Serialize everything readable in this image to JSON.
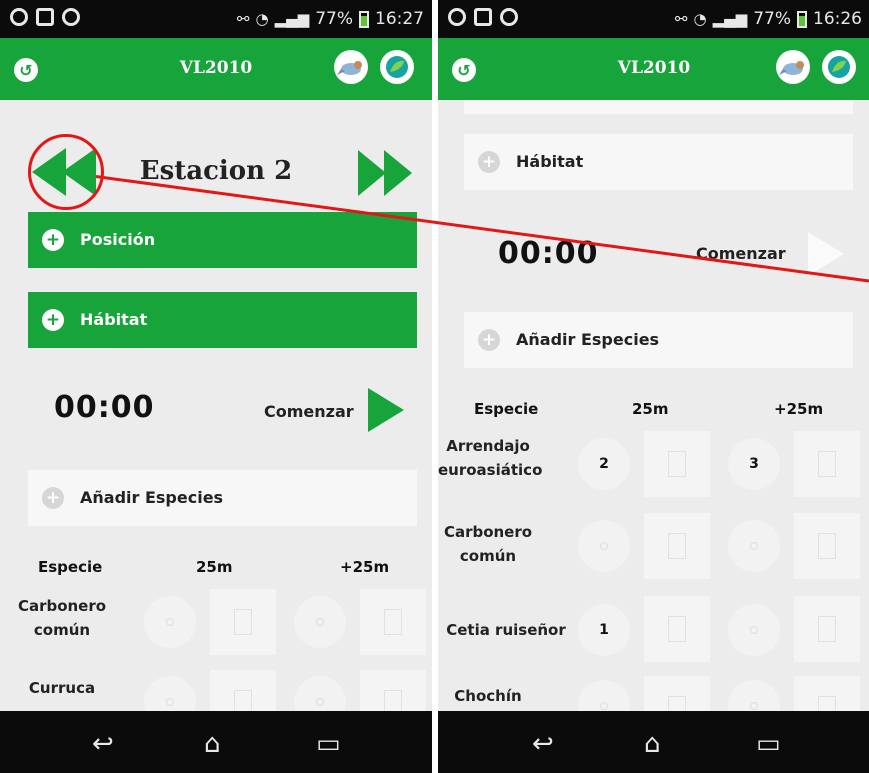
{
  "status_left": {
    "time": "16:27",
    "battery": "77%"
  },
  "status_right": {
    "time": "16:26",
    "battery": "77%"
  },
  "app": {
    "title": "VL2010",
    "back_icon": "back-icon",
    "bird_icon": "bird-icon",
    "leaf_icon": "leaf-icon"
  },
  "left": {
    "station": "Estacion 2",
    "position_label": "Posición",
    "habitat_label": "Hábitat",
    "timer": "00:00",
    "start_label": "Comenzar",
    "add_species_label": "Añadir Especies",
    "headers": {
      "species": "Especie",
      "c25": "25m",
      "c25p": "+25m"
    },
    "rows": [
      {
        "name1": "Carbonero",
        "name2": "común",
        "v25": "",
        "v25p": ""
      },
      {
        "name1": "Curruca",
        "name2": "",
        "v25": "",
        "v25p": ""
      }
    ]
  },
  "right": {
    "habitat_label": "Hábitat",
    "timer": "00:00",
    "start_label": "Comenzar",
    "add_species_label": "Añadir Especies",
    "headers": {
      "species": "Especie",
      "c25": "25m",
      "c25p": "+25m"
    },
    "rows": [
      {
        "name1": "Arrendajo",
        "name2": "euroasiático",
        "v25": "2",
        "v25p": "3"
      },
      {
        "name1": "Carbonero",
        "name2": "común",
        "v25": "",
        "v25p": ""
      },
      {
        "name1": "Cetia ruiseñor",
        "name2": "",
        "v25": "1",
        "v25p": ""
      },
      {
        "name1": "Chochín",
        "name2": "",
        "v25": "",
        "v25p": ""
      }
    ]
  },
  "colors": {
    "brand_green": "#17a43a",
    "annotation_red": "#e41616"
  }
}
